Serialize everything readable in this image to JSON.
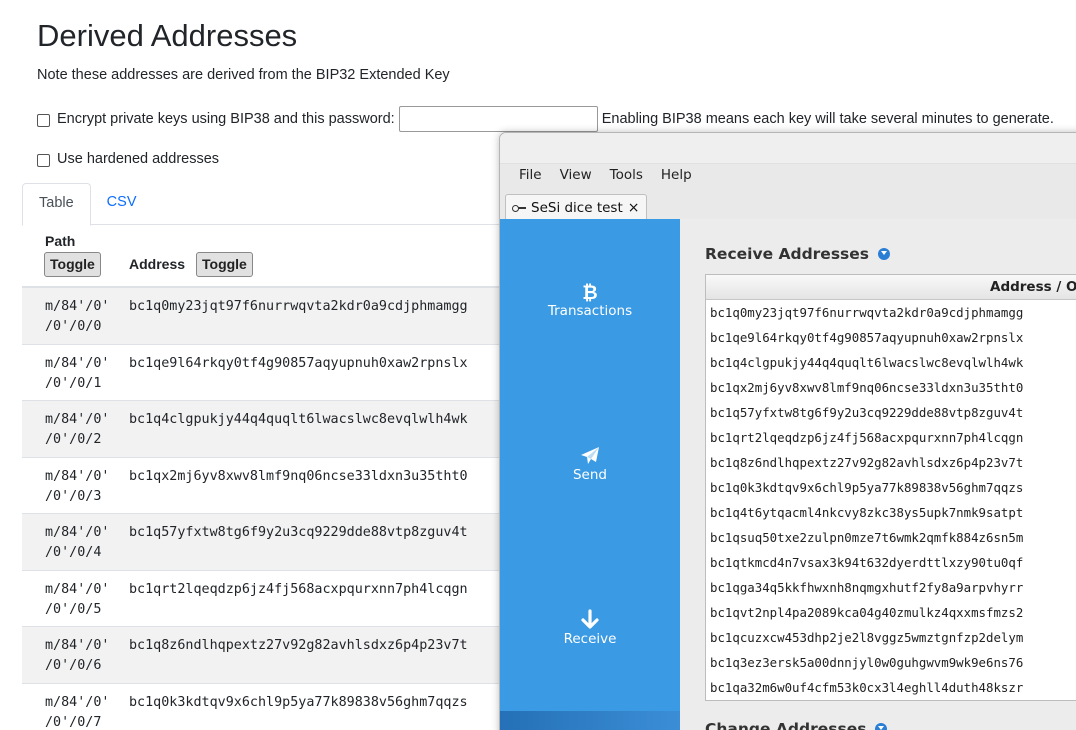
{
  "page": {
    "title": "Derived Addresses",
    "note": "Note these addresses are derived from the BIP32 Extended Key",
    "bip38_label": "Encrypt private keys using BIP38 and this password:",
    "bip38_password": "",
    "bip38_hint": "Enabling BIP38 means each key will take several minutes to generate.",
    "hardened_label": "Use hardened addresses",
    "tabs": [
      {
        "label": "Table",
        "active": true
      },
      {
        "label": "CSV",
        "active": false
      }
    ],
    "table": {
      "path_header": "Path",
      "address_header": "Address",
      "toggle_label": "Toggle",
      "rows": [
        {
          "path": "m/84'/0'\n/0'/0/0",
          "address": "bc1q0my23jqt97f6nurrwqvta2kdr0a9cdjphmamgg"
        },
        {
          "path": "m/84'/0'\n/0'/0/1",
          "address": "bc1qe9l64rkqy0tf4g90857aqyupnuh0xaw2rpnslx"
        },
        {
          "path": "m/84'/0'\n/0'/0/2",
          "address": "bc1q4clgpukjy44q4quqlt6lwacslwc8evqlwlh4wk"
        },
        {
          "path": "m/84'/0'\n/0'/0/3",
          "address": "bc1qx2mj6yv8xwv8lmf9nq06ncse33ldxn3u35tht0"
        },
        {
          "path": "m/84'/0'\n/0'/0/4",
          "address": "bc1q57yfxtw8tg6f9y2u3cq9229dde88vtp8zguv4t"
        },
        {
          "path": "m/84'/0'\n/0'/0/5",
          "address": "bc1qrt2lqeqdzp6jz4fj568acxpqurxnn7ph4lcqgn"
        },
        {
          "path": "m/84'/0'\n/0'/0/6",
          "address": "bc1q8z6ndlhqpextz27v92g82avhlsdxz6p4p23v7t"
        },
        {
          "path": "m/84'/0'\n/0'/0/7",
          "address": "bc1q0k3kdtqv9x6chl9p5ya77k89838v56ghm7qqzs"
        }
      ]
    }
  },
  "app": {
    "menu": [
      "File",
      "View",
      "Tools",
      "Help"
    ],
    "tab_label": "SeSi dice test",
    "tab_close": "×",
    "nav": [
      {
        "label": "Transactions",
        "icon": "bitcoin-icon"
      },
      {
        "label": "Send",
        "icon": "paper-plane-icon"
      },
      {
        "label": "Receive",
        "icon": "arrow-down-icon"
      }
    ],
    "receive_title": "Receive Addresses",
    "change_title": "Change Addresses",
    "column_header": "Address / Ou",
    "addresses": [
      "bc1q0my23jqt97f6nurrwqvta2kdr0a9cdjphmamgg",
      "bc1qe9l64rkqy0tf4g90857aqyupnuh0xaw2rpnslx",
      "bc1q4clgpukjy44q4quqlt6lwacslwc8evqlwlh4wk",
      "bc1qx2mj6yv8xwv8lmf9nq06ncse33ldxn3u35tht0",
      "bc1q57yfxtw8tg6f9y2u3cq9229dde88vtp8zguv4t",
      "bc1qrt2lqeqdzp6jz4fj568acxpqurxnn7ph4lcqgn",
      "bc1q8z6ndlhqpextz27v92g82avhlsdxz6p4p23v7t",
      "bc1q0k3kdtqv9x6chl9p5ya77k89838v56ghm7qqzs",
      "bc1q4t6ytqacml4nkcvy8zkc38ys5upk7nmk9satpt",
      "bc1qsuq50txe2zulpn0mze7t6wmk2qmfk884z6sn5m",
      "bc1qtkmcd4n7vsax3k94t632dyerdttlxzy90tu0qf",
      "bc1qga34q5kkfhwxnh8nqmgxhutf2fy8a9arpvhyrr",
      "bc1qvt2npl4pa2089kca04g40zmulkz4qxxmsfmzs2",
      "bc1qcuzxcw453dhp2je2l8vggz5wmztgnfzp2delym",
      "bc1q3ez3ersk5a00dnnjyl0w0guhgwvm9wk9e6ns76",
      "bc1qa32m6w0uf4cfm53k0cx3l4eghll4duth48kszr"
    ],
    "colors": {
      "sidebar": "#3a9ae3",
      "accent": "#2a7fd4",
      "link": "#0d6efd"
    }
  }
}
